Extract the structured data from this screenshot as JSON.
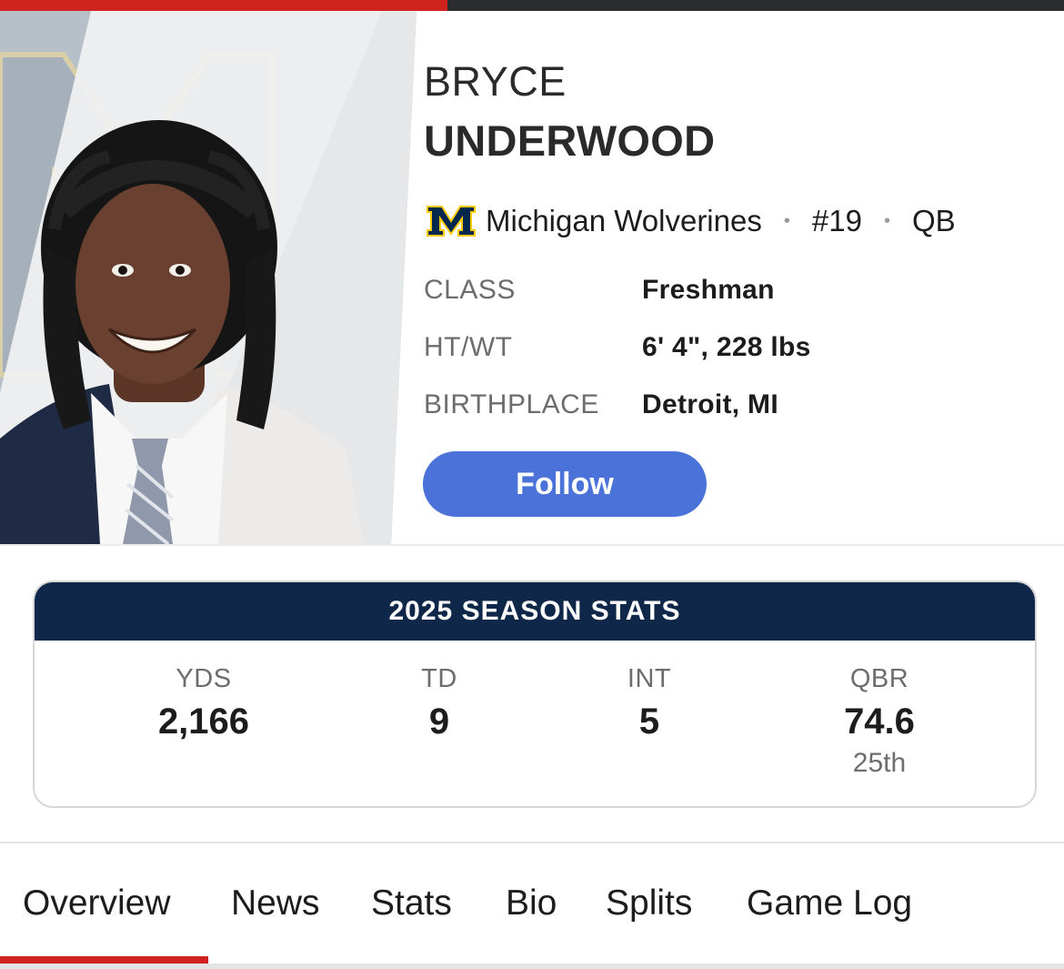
{
  "player": {
    "first_name": "BRYCE",
    "last_name": "UNDERWOOD",
    "team": "Michigan Wolverines",
    "number": "#19",
    "position": "QB",
    "separator": "•"
  },
  "info": [
    {
      "label": "CLASS",
      "value": "Freshman"
    },
    {
      "label": "HT/WT",
      "value": "6' 4\", 228 lbs"
    },
    {
      "label": "BIRTHPLACE",
      "value": "Detroit, MI"
    }
  ],
  "follow_label": "Follow",
  "stats": {
    "title": "2025 SEASON STATS",
    "items": [
      {
        "label": "YDS",
        "value": "2,166"
      },
      {
        "label": "TD",
        "value": "9"
      },
      {
        "label": "INT",
        "value": "5"
      },
      {
        "label": "QBR",
        "value": "74.6",
        "rank": "25th"
      }
    ]
  },
  "tabs": [
    "Overview",
    "News",
    "Stats",
    "Bio",
    "Splits",
    "Game Log"
  ],
  "active_tab": "Overview",
  "colors": {
    "accent": "#d0231f",
    "follow": "#4a72d8",
    "stats_header": "#0f2749",
    "michigan_blue": "#00274c",
    "michigan_maize": "#ffcb05"
  }
}
